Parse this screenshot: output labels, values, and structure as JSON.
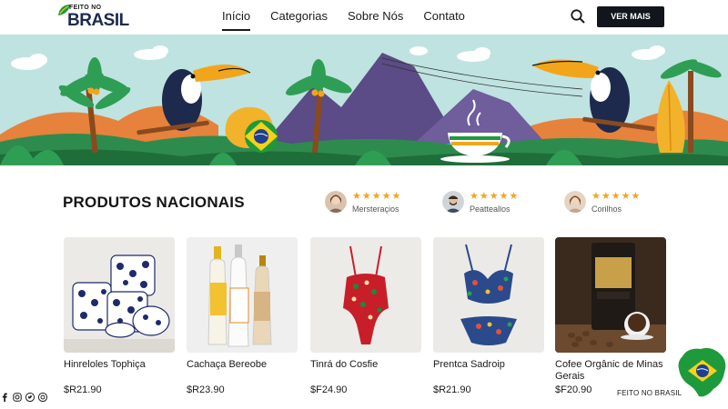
{
  "logo": {
    "top_line": "FEITO NO",
    "main": "BRASIL"
  },
  "nav": {
    "items": [
      {
        "label": "Início",
        "active": true
      },
      {
        "label": "Categorias",
        "active": false
      },
      {
        "label": "Sobre Nós",
        "active": false
      },
      {
        "label": "Contato",
        "active": false
      }
    ]
  },
  "header": {
    "search_icon": "search-icon",
    "cta_label": "VER MAIS"
  },
  "section": {
    "title": "PRODUTOS NACIONAIS"
  },
  "reviews": [
    {
      "stars": "★★★★★",
      "name": "Mersteraçios",
      "rating": 5
    },
    {
      "stars": "★★★★★",
      "name": "Peatteallos",
      "rating": 5
    },
    {
      "stars": "★★★★★",
      "name": "Corilhos",
      "rating": 5
    }
  ],
  "products": [
    {
      "name": "Hinreloles Tophiça",
      "price": "$R21.90"
    },
    {
      "name": "Cachaça Bereobe",
      "price": "$R23.90"
    },
    {
      "name": "Tinrá do Cosfie",
      "price": "$F24.90"
    },
    {
      "name": "Prentca Sadroip",
      "price": "$R21.90"
    },
    {
      "name": "Cofee Orgânic de Minas Gerais",
      "price": "$F20.90"
    }
  ],
  "footer": {
    "brand": "FEITO NO BRASIL",
    "social_icons": [
      "facebook-icon",
      "instagram-icon",
      "twitter-icon",
      "pinterest-icon"
    ]
  },
  "colors": {
    "primary_dark": "#12161c",
    "brand_navy": "#1d2a4d",
    "star": "#f2a51a",
    "brazil_green": "#1e9a3c",
    "brazil_yellow": "#f7d117",
    "brazil_blue": "#1f3f8f"
  }
}
